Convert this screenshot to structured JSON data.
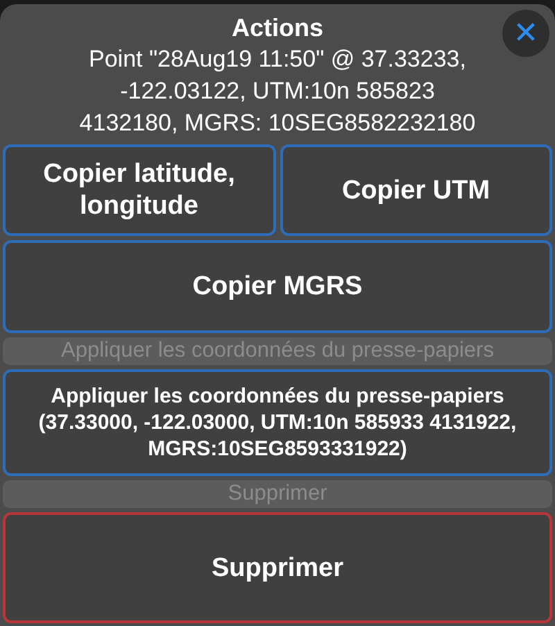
{
  "title": "Actions",
  "close": "✕",
  "description": "Point \"28Aug19 11:50\" @ 37.33233, -122.03122, UTM:10n 585823 4132180, MGRS: 10SEG8582232180",
  "rows": [
    [
      {
        "kind": "button",
        "label": "Copier latitude, longitude"
      },
      {
        "kind": "button",
        "label": "Copier UTM"
      }
    ],
    [
      {
        "kind": "button",
        "label": "Copier MGRS"
      }
    ],
    [
      {
        "kind": "header",
        "label": "Appliquer les coordonnées du presse-papiers"
      }
    ],
    [
      {
        "kind": "small",
        "label": "Appliquer les coordonnées du presse-papiers (37.33000, -122.03000, UTM:10n 585933 4131922, MGRS:10SEG8593331922)"
      }
    ],
    [
      {
        "kind": "header",
        "label": "Supprimer"
      }
    ],
    [
      {
        "kind": "danger",
        "label": "Supprimer"
      }
    ]
  ]
}
